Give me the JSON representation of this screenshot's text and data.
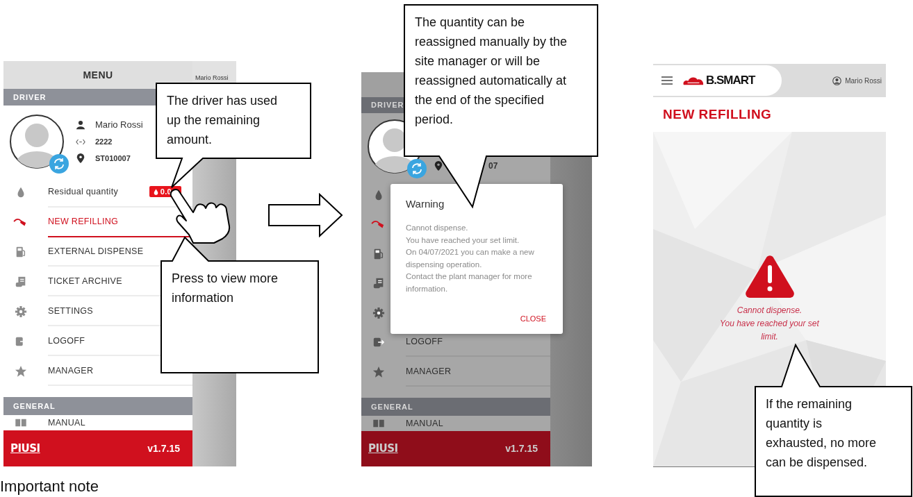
{
  "menu_screen": {
    "title": "MENU",
    "side_user": "Mario Rossi",
    "driver_section": "DRIVER",
    "profile": {
      "name": "Mario Rossi",
      "code": "2222",
      "station": "ST010007"
    },
    "items": [
      {
        "kind": "drop",
        "label": "Residual quantity",
        "badge": "0.0",
        "selected": false
      },
      {
        "kind": "nozzle",
        "label": "NEW REFILLING",
        "selected": true
      },
      {
        "kind": "pump",
        "label": "EXTERNAL DISPENSE",
        "selected": false
      },
      {
        "kind": "ticket",
        "label": "TICKET ARCHIVE",
        "selected": false
      },
      {
        "kind": "gear",
        "label": "SETTINGS",
        "selected": false
      },
      {
        "kind": "logout",
        "label": "LOGOFF",
        "selected": false
      },
      {
        "kind": "star",
        "label": "MANAGER",
        "selected": false
      }
    ],
    "general_section": "GENERAL",
    "general_items": [
      {
        "kind": "book",
        "label": "MANUAL"
      }
    ],
    "footer": {
      "logo": "PIUSI",
      "version": "v1.7.15"
    }
  },
  "warning_screen": {
    "driver_section": "DRIVER",
    "station": "07",
    "items": [
      {
        "kind": "drop"
      },
      {
        "kind": "nozzle"
      },
      {
        "kind": "pump"
      },
      {
        "kind": "ticket"
      },
      {
        "kind": "gear"
      },
      {
        "kind": "logout",
        "label": "LOGOFF"
      },
      {
        "kind": "star",
        "label": "MANAGER"
      }
    ],
    "general_section": "GENERAL",
    "general_items": [
      {
        "kind": "book",
        "label": "MANUAL"
      }
    ],
    "footer": {
      "logo": "PIUSI",
      "version": "v1.7.15"
    },
    "dialog": {
      "title": "Warning",
      "lines": [
        "Cannot dispense.",
        "You have reached your set limit.",
        "On 04/07/2021 you can make a new dispensing operation.",
        "Contact the plant manager for more information."
      ],
      "button": "CLOSE"
    }
  },
  "refilling_screen": {
    "logo": "B.SMART",
    "user": "Mario Rossi",
    "title": "NEW REFILLING",
    "message_lines": [
      "Cannot dispense.",
      "You have reached your set",
      "limit."
    ]
  },
  "callouts": [
    "The driver has used up the remaining amount.",
    "Press to view more information",
    "The quantity can be reassigned manually by the site manager or will be reassigned automatically at the end of the specified period.",
    "If the remaining quantity is exhausted, no more can be dispensed."
  ],
  "heading": "Important note"
}
